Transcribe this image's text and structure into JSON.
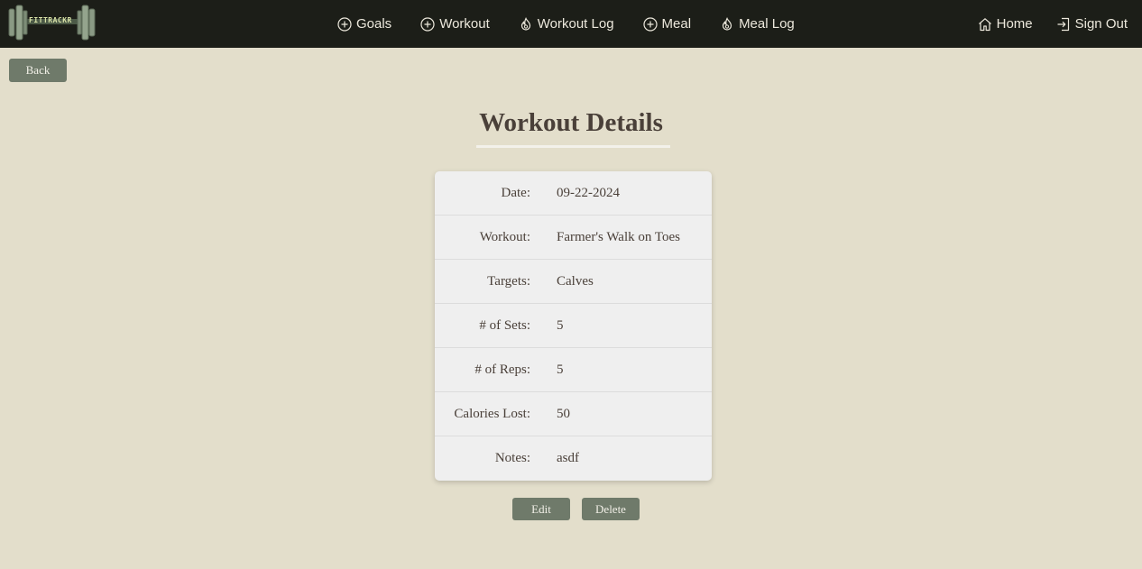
{
  "nav": {
    "logo_text": "FITTRACKR",
    "items": [
      {
        "label": "Goals",
        "icon": "plus-circle-icon"
      },
      {
        "label": "Workout",
        "icon": "plus-circle-icon"
      },
      {
        "label": "Workout Log",
        "icon": "flame-icon"
      },
      {
        "label": "Meal",
        "icon": "plus-circle-icon"
      },
      {
        "label": "Meal Log",
        "icon": "flame-icon"
      }
    ],
    "home_label": "Home",
    "signout_label": "Sign Out"
  },
  "back_label": "Back",
  "page_title": "Workout Details",
  "details": [
    {
      "label": "Date:",
      "value": "09-22-2024"
    },
    {
      "label": "Workout:",
      "value": "Farmer's Walk on Toes"
    },
    {
      "label": "Targets:",
      "value": "Calves"
    },
    {
      "label": "# of Sets:",
      "value": "5"
    },
    {
      "label": "# of Reps:",
      "value": "5"
    },
    {
      "label": "Calories Lost:",
      "value": "50"
    },
    {
      "label": "Notes:",
      "value": "asdf"
    }
  ],
  "edit_label": "Edit",
  "delete_label": "Delete",
  "colors": {
    "navbar": "#1c1e18",
    "background": "#e3decb",
    "button": "#6f7a6a",
    "card": "#efefef"
  }
}
